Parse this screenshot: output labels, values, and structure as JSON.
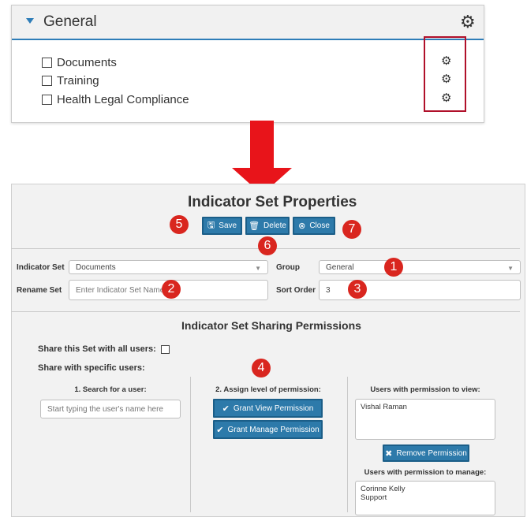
{
  "top_panel": {
    "title": "General",
    "items": [
      {
        "label": "Documents"
      },
      {
        "label": "Training"
      },
      {
        "label": "Health Legal Compliance"
      }
    ]
  },
  "dialog": {
    "title": "Indicator Set Properties",
    "buttons": {
      "save": "Save",
      "delete": "Delete",
      "close": "Close"
    },
    "form": {
      "indicator_set_label": "Indicator Set",
      "indicator_set_value": "Documents",
      "group_label": "Group",
      "group_value": "General",
      "rename_label": "Rename Set",
      "rename_placeholder": "Enter Indicator Set Name",
      "sort_label": "Sort Order",
      "sort_value": "3"
    },
    "sharing": {
      "title": "Indicator Set Sharing Permissions",
      "share_all_label": "Share this Set with all users:",
      "share_specific_label": "Share with specific users:",
      "col1_title": "1. Search for a user:",
      "search_placeholder": "Start typing the user's name here",
      "col2_title": "2. Assign level of permission:",
      "grant_view": "Grant View Permission",
      "grant_manage": "Grant Manage Permission",
      "view_title": "Users with permission to view:",
      "view_users": "Vishal Raman",
      "remove": "Remove Permission",
      "manage_title": "Users with permission to manage:",
      "manage_users_1": "Corinne Kelly",
      "manage_users_2": "Support"
    }
  },
  "callouts": [
    "1",
    "2",
    "3",
    "4",
    "5",
    "6",
    "7"
  ],
  "colors": {
    "accent_blue": "#2d7aaa",
    "callout_red": "#d9261f",
    "highlight_red": "#b0102a",
    "arrow_red": "#e8141a"
  }
}
